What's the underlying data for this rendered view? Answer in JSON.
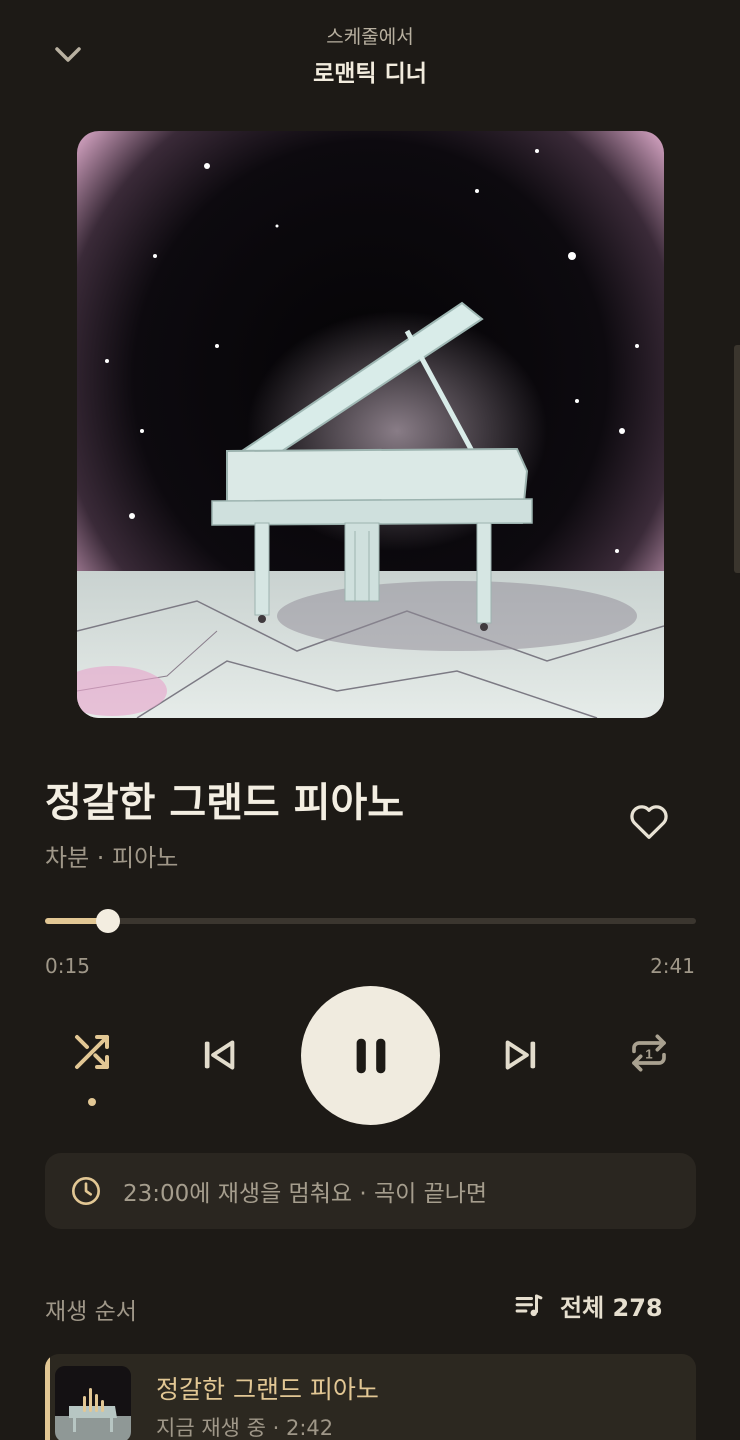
{
  "header": {
    "source_label": "스케줄에서",
    "schedule_name": "로맨틱 디너",
    "collapse_icon": "chevron-down-icon"
  },
  "track": {
    "title": "정갈한 그랜드 피아노",
    "meta": "차분 · 피아노",
    "favorite_icon": "heart-outline-icon"
  },
  "progress": {
    "current": "0:15",
    "total": "2:41",
    "fraction": 0.0969
  },
  "controls": {
    "shuffle_icon": "shuffle-icon",
    "shuffle_active": true,
    "prev_icon": "skip-previous-icon",
    "play_state_icon": "pause-icon",
    "next_icon": "skip-next-icon",
    "repeat_icon": "repeat-one-icon"
  },
  "sleep_timer": {
    "icon": "clock-icon",
    "text": "23:00에 재생을 멈춰요 · 곡이 끝나면"
  },
  "queue": {
    "label": "재생 순서",
    "all_icon": "queue-music-icon",
    "all_label": "전체 278",
    "items": [
      {
        "title": "정갈한 그랜드 피아노",
        "subtitle": "지금 재생 중 · 2:42"
      }
    ]
  },
  "colors": {
    "background": "#1d1a16",
    "accent": "#e2c794",
    "play_button": "#f0ebdf"
  }
}
